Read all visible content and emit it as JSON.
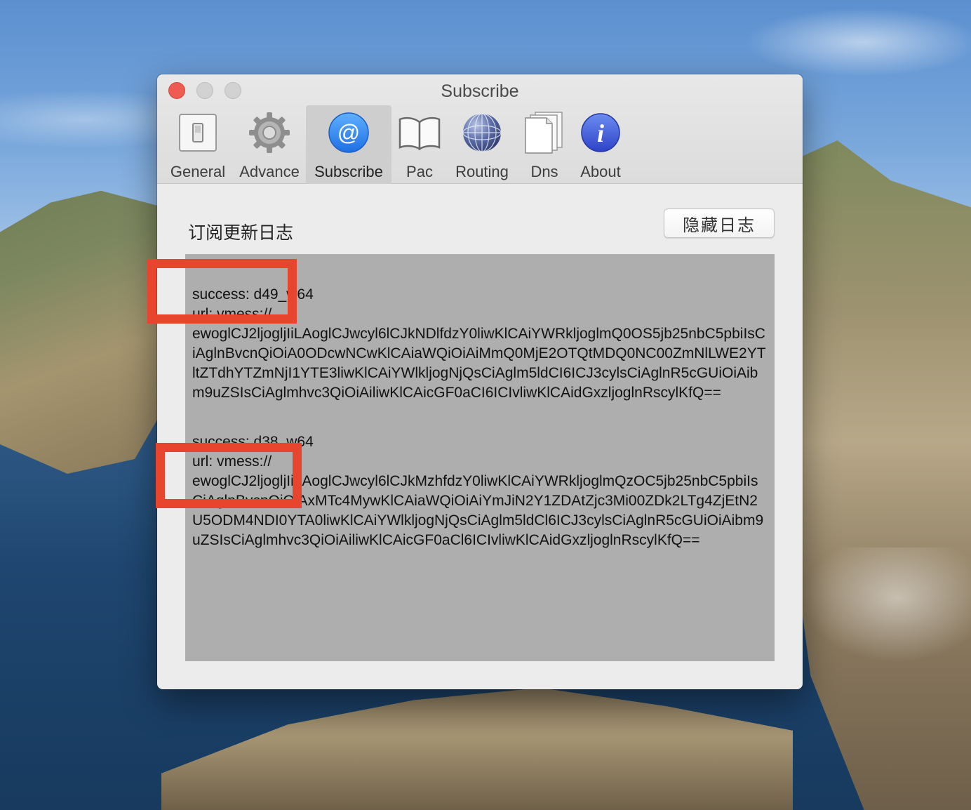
{
  "window": {
    "title": "Subscribe"
  },
  "toolbar": {
    "items": [
      {
        "label": "General",
        "icon": "switch-icon"
      },
      {
        "label": "Advance",
        "icon": "gear-icon"
      },
      {
        "label": "Subscribe",
        "icon": "at-sign-icon",
        "active": true
      },
      {
        "label": "Pac",
        "icon": "book-icon"
      },
      {
        "label": "Routing",
        "icon": "globe-icon"
      },
      {
        "label": "Dns",
        "icon": "documents-icon"
      },
      {
        "label": "About",
        "icon": "info-icon"
      }
    ]
  },
  "content": {
    "section_title": "订阅更新日志",
    "hide_button_label": "隐藏日志",
    "log": [
      {
        "status_line": "success: d49_w64",
        "url_line": "url: vmess://",
        "payload": "ewoglCJ2ljogljIiLAoglCJwcyl6lCJkNDlfdzY0liwKlCAiYWRkljoglmQ0OS5jb25nbC5pbiIsCiAglnBvcnQiOiA0ODcwNCwKlCAiaWQiOiAiMmQ0MjE2OTQtMDQ0NC00ZmNlLWE2YTltZTdhYTZmNjI1YTE3liwKlCAiYWlkljogNjQsCiAglm5ldCI6ICJ3cylsCiAglnR5cGUiOiAibm9uZSIsCiAglmhvc3QiOiAiliwKlCAicGF0aCI6ICIvliwKlCAidGxzljoglnRscylKfQ=="
      },
      {
        "status_line": "success: d38_w64",
        "url_line": "url: vmess://",
        "payload": "ewoglCJ2ljogljIiLAoglCJwcyl6lCJkMzhfdzY0liwKlCAiYWRkljoglmQzOC5jb25nbC5pbiIsCiAglnBvcnQiOiAxMTc4MywKlCAiaWQiOiAiYmJiN2Y1ZDAtZjc3Mi00ZDk2LTg4ZjEtN2U5ODM4NDI0YTA0liwKlCAiYWlkljogNjQsCiAglm5ldCl6ICJ3cylsCiAglnR5cGUiOiAibm9uZSIsCiAglmhvc3QiOiAiliwKlCAicGF0aCl6ICIvliwKlCAidGxzljoglnRscylKfQ=="
      }
    ]
  },
  "colors": {
    "close": "#ee5b52",
    "log_background": "#aeaeae",
    "highlight": "#e8452e",
    "accent": "#2f7ef1"
  }
}
